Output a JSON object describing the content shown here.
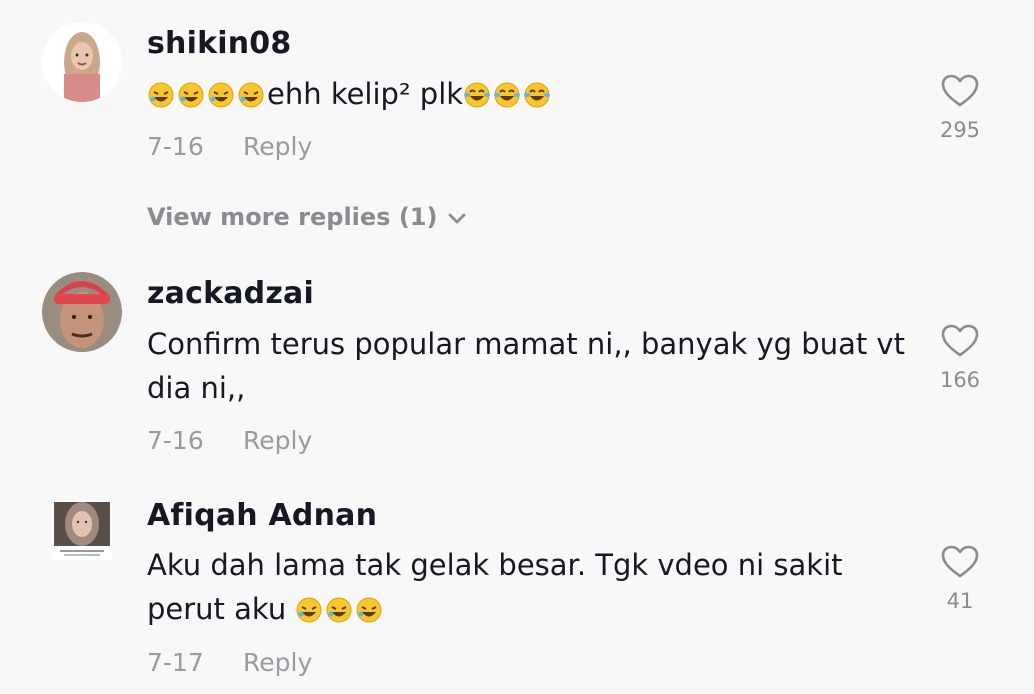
{
  "comments": [
    {
      "username": "shikin08",
      "prefix_emojis": [
        "rolling-laughing",
        "rolling-laughing",
        "rolling-laughing",
        "rolling-laughing"
      ],
      "text": "ehh kelip² plk",
      "suffix_emojis": [
        "tears-of-joy",
        "tears-of-joy",
        "tears-of-joy"
      ],
      "date": "7-16",
      "reply_label": "Reply",
      "likes": "295"
    },
    {
      "username": "zackadzai",
      "text": "Confirm terus popular mamat ni,, banyak yg buat vt dia ni,,",
      "date": "7-16",
      "reply_label": "Reply",
      "likes": "166"
    },
    {
      "username": "Afiqah Adnan",
      "text": "Aku dah lama tak gelak besar. Tgk vdeo ni sakit perut aku ",
      "suffix_emojis": [
        "rolling-laughing",
        "rolling-laughing",
        "rolling-laughing"
      ],
      "date": "7-17",
      "reply_label": "Reply",
      "likes": "41"
    }
  ],
  "view_more_replies": "View more replies (1)",
  "icons": {
    "like": "heart-outline-icon",
    "expand": "chevron-down-icon"
  },
  "colors": {
    "background": "#f8f8f8",
    "text": "#161823",
    "muted": "#8a8b91"
  }
}
